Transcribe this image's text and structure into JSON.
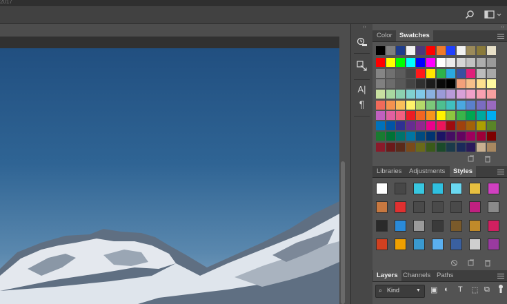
{
  "app": {
    "title_fragment": "2017"
  },
  "optbar": {
    "search_icon": "search-icon",
    "workspace_icon": "workspace-icon"
  },
  "color_panel": {
    "tabs": [
      {
        "label": "Color",
        "active": false
      },
      {
        "label": "Swatches",
        "active": true
      }
    ],
    "swatch_rows": [
      [
        "#000000",
        "#7f7f7f",
        "#1e3c8c",
        "#f2f2f2",
        "#4b3a7a",
        "#ff0000",
        "#f07a2a",
        "#2040ff",
        "#f2f2f2",
        "#9b8a5a",
        "#8a7a3a",
        "#e8e0c8"
      ],
      [
        "#ff0000",
        "#ffff00",
        "#00ff00",
        "#00ffff",
        "#0000ff",
        "#ff00ff",
        "#ffffff",
        "#ebebeb",
        "#d6d6d6",
        "#c2c2c2",
        "#adadad",
        "#999999"
      ],
      [
        "#858585",
        "#707070",
        "#5c5c5c",
        "#474747",
        "#ff1a1a",
        "#ffe600",
        "#2db34a",
        "#2aa8e0",
        "#3a4fa0",
        "#e0207a",
        "#bcbcbc",
        "#a8a8a8"
      ],
      [
        "#808080",
        "#6c6c6c",
        "#585858",
        "#444444",
        "#303030",
        "#1c1c1c",
        "#0a0a0a",
        "#000000",
        "#f3a07a",
        "#f6c08a",
        "#fde08e",
        "#fffaa0"
      ],
      [
        "#c8e0a0",
        "#a8d8a0",
        "#8cd0b0",
        "#80d0d0",
        "#80c8e8",
        "#8ab0e0",
        "#9a9ad8",
        "#b89ad8",
        "#d8a0d8",
        "#f0a0c8",
        "#f8a0b0",
        "#f6a0a0"
      ],
      [
        "#f06a5a",
        "#f5924f",
        "#fabf5a",
        "#fff36a",
        "#b5d96a",
        "#7cc77a",
        "#4dbf90",
        "#40bfbf",
        "#4aa8e0",
        "#5a80cc",
        "#7a6cc0",
        "#9a6abf"
      ],
      [
        "#c060bf",
        "#e060a0",
        "#f06080",
        "#ed1c24",
        "#f26522",
        "#f7941d",
        "#fff200",
        "#8dc63f",
        "#39b54a",
        "#00a651",
        "#00a99d",
        "#00aeef"
      ],
      [
        "#0072bc",
        "#0054a6",
        "#2e3192",
        "#662d91",
        "#92278f",
        "#ec008c",
        "#ed145b",
        "#9e0b0f",
        "#a0410d",
        "#a36209",
        "#aba000",
        "#598527"
      ],
      [
        "#197b30",
        "#007236",
        "#00746b",
        "#0076a3",
        "#004b80",
        "#003471",
        "#1b1464",
        "#440e62",
        "#630460",
        "#9e005d",
        "#9e0039",
        "#7d0000"
      ],
      [
        "#8a1a2a",
        "#6a1a1a",
        "#5a2a1a",
        "#7a4a1a",
        "#6a6a1a",
        "#3a5a1a",
        "#1a4a2a",
        "#1a3a4a",
        "#1a2a5a",
        "#2a1a5a",
        "#c8b090",
        "#a88860"
      ]
    ]
  },
  "styles_panel": {
    "tabs": [
      {
        "label": "Libraries",
        "active": false
      },
      {
        "label": "Adjustments",
        "active": false
      },
      {
        "label": "Styles",
        "active": true
      }
    ],
    "style_rows": [
      [
        "#ffffff",
        "#474747",
        "#38c7e0",
        "#2fc0e0",
        "#6ad8f0",
        "#e8c040",
        "#d040c0"
      ],
      [
        "#c87840",
        "#e03030",
        "#4a4a4a",
        "#4a4a4a",
        "#4a4a4a",
        "#c02080",
        "#8a8a8a"
      ],
      [
        "#2a2a2a",
        "#2a8ad8",
        "#9a9a9a",
        "#3a3a3a",
        "#7a5a2a",
        "#c08a2a",
        "#d02060"
      ],
      [
        "#d04020",
        "#f0a000",
        "#3a9ad0",
        "#5ab0f0",
        "#3a60a0",
        "#cfcfcf",
        "#9a3aa0"
      ]
    ]
  },
  "layers_panel": {
    "tabs": [
      {
        "label": "Layers",
        "active": true
      },
      {
        "label": "Channels",
        "active": false
      },
      {
        "label": "Paths",
        "active": false
      }
    ],
    "filter_label": "Kind"
  }
}
